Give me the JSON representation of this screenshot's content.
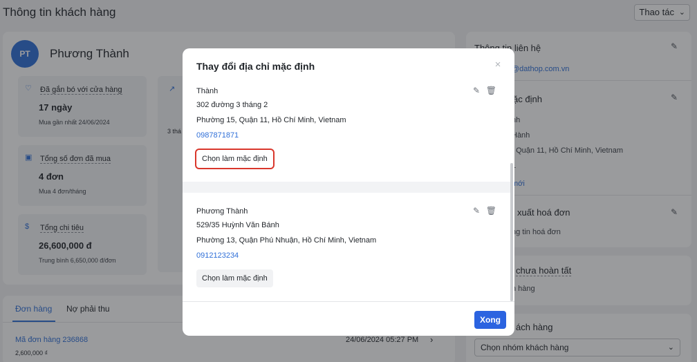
{
  "page": {
    "title": "Thông tin khách hàng",
    "actions_label": "Thao tác",
    "actions_chevron": "⌄"
  },
  "customer": {
    "initials": "PT",
    "name": "Phương Thành"
  },
  "stats": [
    {
      "label": "Đã gắn bó với cửa hàng",
      "value": "17 ngày",
      "sub": "Mua gần nhất 24/06/2024",
      "icon": "heart-icon"
    },
    {
      "label": "Tổng số đơn đã mua",
      "value": "4 đơn",
      "sub": "Mua 4 đơn/tháng",
      "icon": "bag-icon"
    },
    {
      "label": "Tổng chi tiêu",
      "value": "26,600,000 đ",
      "sub": "Trung bình 6,650,000 đ/đơn",
      "icon": "dollar-icon"
    }
  ],
  "mid_stat": {
    "text": "3 thá"
  },
  "orders": {
    "tabs": [
      "Đơn hàng",
      "Nợ phải thu"
    ],
    "item": {
      "link": "Mã đơn hàng 236868",
      "amount": "2,600,000 ₫",
      "date": "24/06/2024 05:27 PM"
    }
  },
  "right_panel": {
    "contact_title": "Thông tin liên hệ",
    "contact_email": "@dathop.com.vn",
    "default_title": "ặc định",
    "default_lines": [
      "nh",
      "Hành",
      ", Quận 11, Hồ Chí Minh, Vietnam",
      "1"
    ],
    "default_link": "mới",
    "invoice_title": "xuất hoá đơn",
    "invoice_text": "ng tin hoá đơn",
    "pending_title": "chưa hoàn tất",
    "pending_text": "n hàng",
    "group_title": "ách hàng",
    "group_select": "Chọn nhóm khách hàng"
  },
  "modal": {
    "title": "Thay đổi địa chỉ mặc định",
    "close": "×",
    "done_label": "Xong",
    "addresses": [
      {
        "name": "Thành",
        "street": "302 đường 3 tháng 2",
        "area": "Phường 15, Quận 11, Hồ Chí Minh, Vietnam",
        "phone": "0987871871",
        "button": "Chọn làm mặc định"
      },
      {
        "name": "Phương Thành",
        "street": "529/35 Huỳnh Văn Bánh",
        "area": "Phường 13, Quận Phú Nhuận, Hồ Chí Minh, Vietnam",
        "phone": "0912123234",
        "button": "Chọn làm mặc định"
      }
    ]
  },
  "colors": {
    "accent": "#2b63e0",
    "highlight": "#d9362b"
  }
}
